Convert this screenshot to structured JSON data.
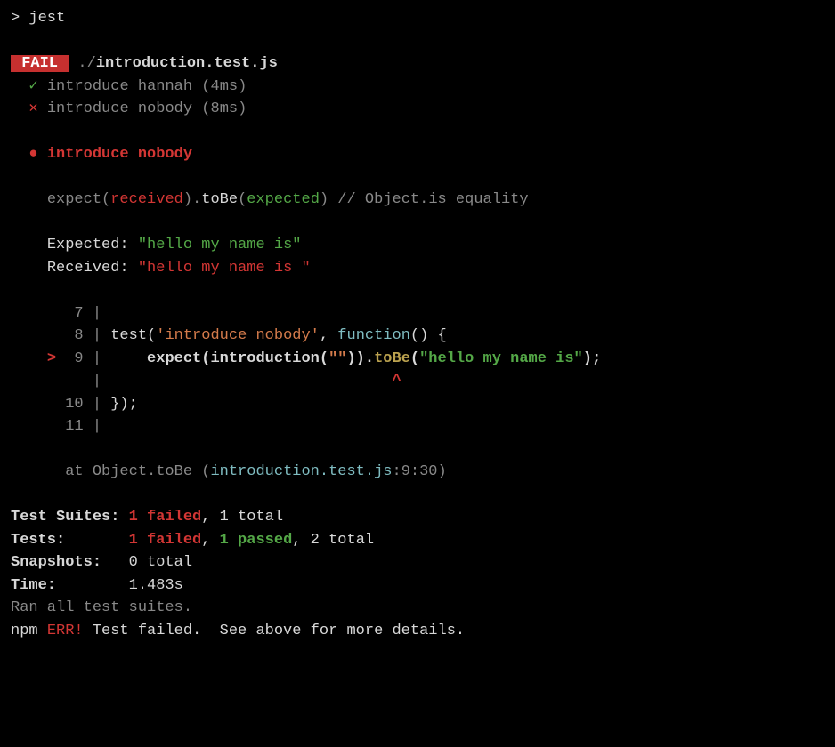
{
  "prompt": "> jest",
  "fail_badge": " FAIL ",
  "file_prefix": " ./",
  "file_name": "introduction.test.js",
  "test_results": [
    {
      "mark": "✓",
      "mark_class": "green",
      "name": "introduce hannah",
      "time": "(4ms)"
    },
    {
      "mark": "✕",
      "mark_class": "red",
      "name": "introduce nobody",
      "time": "(8ms)"
    }
  ],
  "failed_bullet": "●",
  "failed_name": "introduce nobody",
  "expect_line": {
    "expect": "expect(",
    "received": "received",
    "mid1": ").",
    "toBe": "toBe",
    "open": "(",
    "expected": "expected",
    "close": ")",
    "comment": " // Object.is equality"
  },
  "diff": {
    "expected_label": "Expected: ",
    "expected_value": "\"hello my name is\"",
    "received_label": "Received: ",
    "received_value": "\"hello my name is \""
  },
  "code": {
    "l7_num": " 7",
    "l8_num": " 8",
    "l8_pre": "test(",
    "l8_str": "'introduce nobody'",
    "l8_mid": ", ",
    "l8_func": "function",
    "l8_end": "() {",
    "l9_marker": ">",
    "l9_num": " 9",
    "l9_pre": "    expect(introduction(",
    "l9_str": "\"\"",
    "l9_mid": ")).",
    "l9_tobe": "toBe",
    "l9_open": "(",
    "l9_arg": "\"hello my name is\"",
    "l9_close": ");",
    "caret_pad": "                               ",
    "caret": "^",
    "l10_num": "10",
    "l10_text": "});",
    "l11_num": "11"
  },
  "stack": {
    "prefix": "at Object.toBe (",
    "file": "introduction.test.js",
    "loc": ":9:30)"
  },
  "summary": {
    "suites_label": "Test Suites: ",
    "suites_failed": "1 failed",
    "suites_rest": ", 1 total",
    "tests_label": "Tests:       ",
    "tests_failed": "1 failed",
    "tests_mid": ", ",
    "tests_passed": "1 passed",
    "tests_rest": ", 2 total",
    "snapshots_label": "Snapshots:   ",
    "snapshots_val": "0 total",
    "time_label": "Time:        ",
    "time_val": "1.483s",
    "ran": "Ran all test suites."
  },
  "npm": {
    "pre": "npm ",
    "err": "ERR!",
    "msg": " Test failed.  See above for more details."
  }
}
